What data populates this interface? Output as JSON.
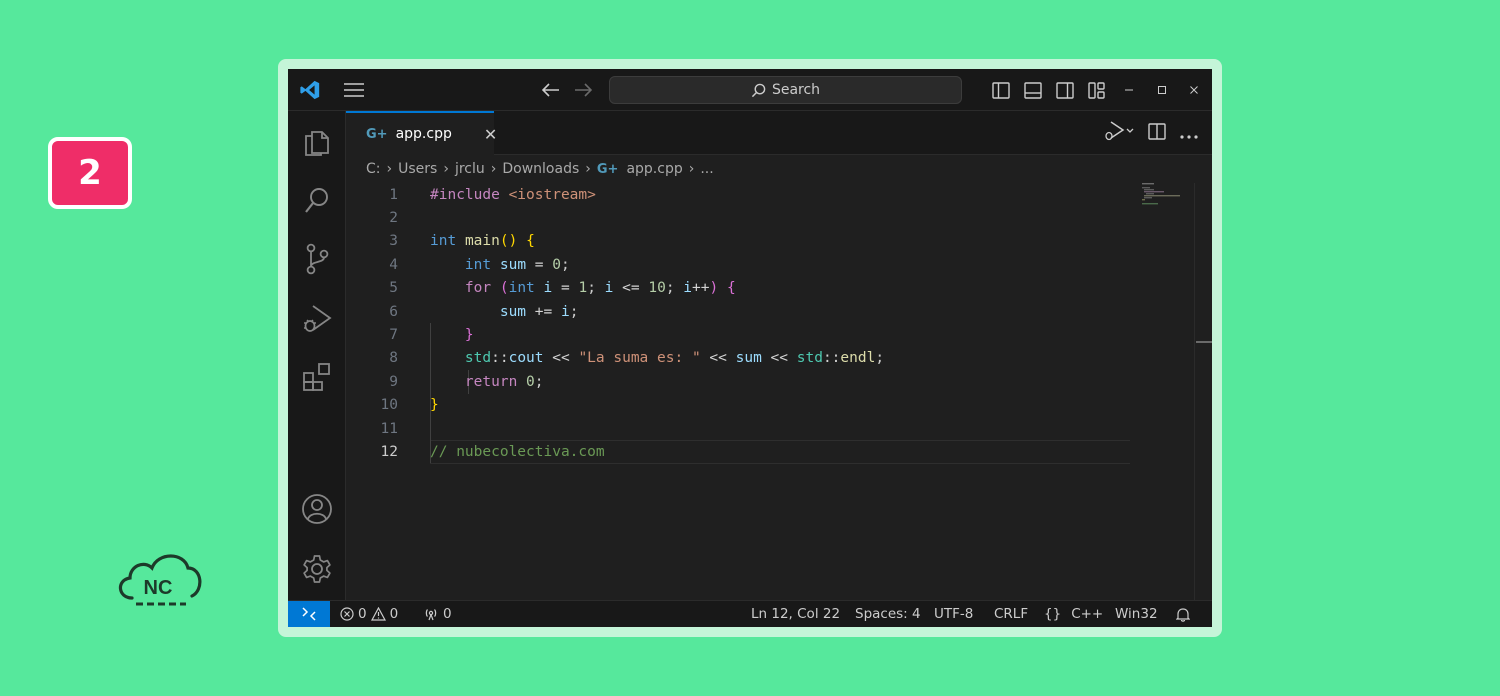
{
  "badge": {
    "number": "2"
  },
  "logo": {
    "text": "NC"
  },
  "titlebar": {
    "search_label": "Search",
    "icons": [
      "vscode-logo-icon",
      "menu-icon",
      "back-arrow-icon",
      "forward-arrow-icon",
      "search-icon",
      "toggle-primary-sidebar-icon",
      "toggle-panel-icon",
      "toggle-secondary-sidebar-icon",
      "customize-layout-icon",
      "minimize-icon",
      "maximize-icon",
      "close-icon"
    ]
  },
  "activity_bar": {
    "items": [
      "explorer-icon",
      "search-icon",
      "source-control-icon",
      "run-debug-icon",
      "extensions-icon"
    ],
    "bottom": [
      "account-icon",
      "settings-gear-icon"
    ]
  },
  "tab": {
    "label": "app.cpp",
    "close": "✕"
  },
  "breadcrumb": {
    "drive": "C:",
    "users": "Users",
    "user": "jrclu",
    "downloads": "Downloads",
    "file": "app.cpp",
    "ellipsis": "..."
  },
  "editor": {
    "line_numbers": [
      "1",
      "2",
      "3",
      "4",
      "5",
      "6",
      "7",
      "8",
      "9",
      "10",
      "11",
      "12"
    ],
    "active_line": 12
  },
  "status": {
    "errors": "0",
    "warnings": "0",
    "ports": "0",
    "position": "Ln 12, Col 22",
    "spaces": "Spaces: 4",
    "encoding": "UTF-8",
    "eol": "CRLF",
    "language": "C++",
    "language_braces": "{}",
    "platform": "Win32"
  },
  "colors": {
    "accent": "#0078d4",
    "badge": "#ef2d68",
    "background": "#56e89c"
  }
}
